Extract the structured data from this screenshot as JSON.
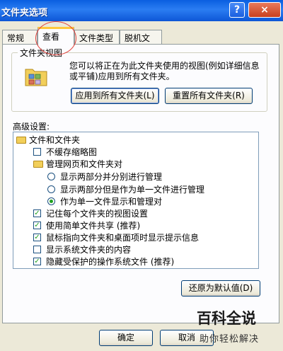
{
  "window": {
    "title": "文件夹选项",
    "help_symbol": "?",
    "close_symbol": "×"
  },
  "tabs": [
    {
      "label": "常规"
    },
    {
      "label": "查看",
      "active": true
    },
    {
      "label": "文件类型"
    },
    {
      "label": "脱机文件"
    }
  ],
  "folder_views": {
    "group_title": "文件夹视图",
    "description": "您可以将正在为此文件夹使用的视图(例如详细信息或平铺)应用到所有文件夹。",
    "apply_button": "应用到所有文件夹(L)",
    "reset_button": "重置所有文件夹(R)"
  },
  "advanced": {
    "label": "高级设置:",
    "items": [
      {
        "type": "folder",
        "label": "文件和文件夹"
      },
      {
        "type": "checkbox",
        "label": "不缓存缩略图",
        "checked": false
      },
      {
        "type": "folder",
        "label": "管理网页和文件夹对"
      },
      {
        "type": "radio",
        "label": "显示两部分并分别进行管理",
        "checked": false
      },
      {
        "type": "radio",
        "label": "显示两部分但是作为单一文件进行管理",
        "checked": false
      },
      {
        "type": "radio",
        "label": "作为单一文件显示和管理对",
        "checked": true
      },
      {
        "type": "checkbox",
        "label": "记住每个文件夹的视图设置",
        "checked": true
      },
      {
        "type": "checkbox",
        "label": "使用简单文件共享 (推荐)",
        "checked": true
      },
      {
        "type": "checkbox",
        "label": "鼠标指向文件夹和桌面项时显示提示信息",
        "checked": true
      },
      {
        "type": "checkbox",
        "label": "显示系统文件夹的内容",
        "checked": false
      },
      {
        "type": "checkbox",
        "label": "隐藏受保护的操作系统文件 (推荐)",
        "checked": true
      }
    ],
    "restore_button": "还原为默认值(D)"
  },
  "footer": {
    "ok_button": "确定",
    "cancel_button": "取消"
  },
  "watermark": {
    "main": "百科全说",
    "sub": "助你轻松解决"
  },
  "colors": {
    "titlebar": "#0a5fe0",
    "active_tab_accent": "#ffc83c",
    "annotation_circle": "#e2403a"
  }
}
